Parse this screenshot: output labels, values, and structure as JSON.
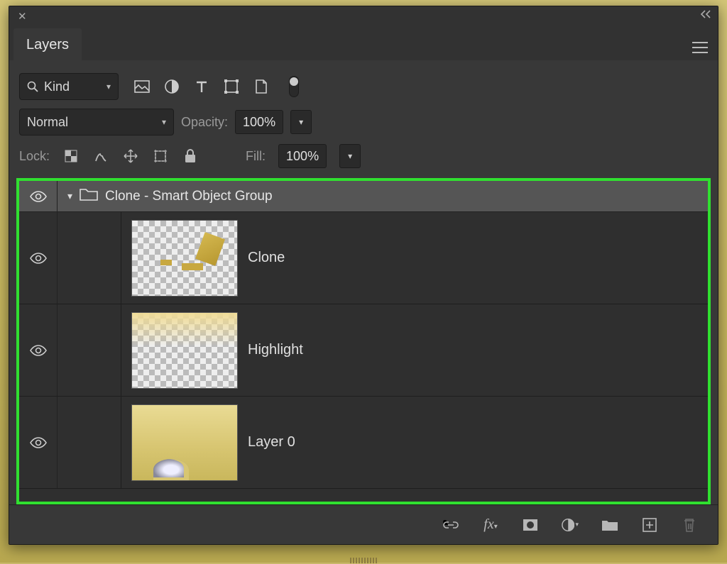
{
  "panel": {
    "title": "Layers"
  },
  "filter": {
    "mode": "Kind"
  },
  "blend": {
    "mode": "Normal"
  },
  "opacity": {
    "label": "Opacity:",
    "value": "100%"
  },
  "fill": {
    "label": "Fill:",
    "value": "100%"
  },
  "lock": {
    "label": "Lock:"
  },
  "group": {
    "name": "Clone - Smart Object Group"
  },
  "layers": [
    {
      "name": "Clone"
    },
    {
      "name": "Highlight"
    },
    {
      "name": "Layer 0"
    }
  ]
}
